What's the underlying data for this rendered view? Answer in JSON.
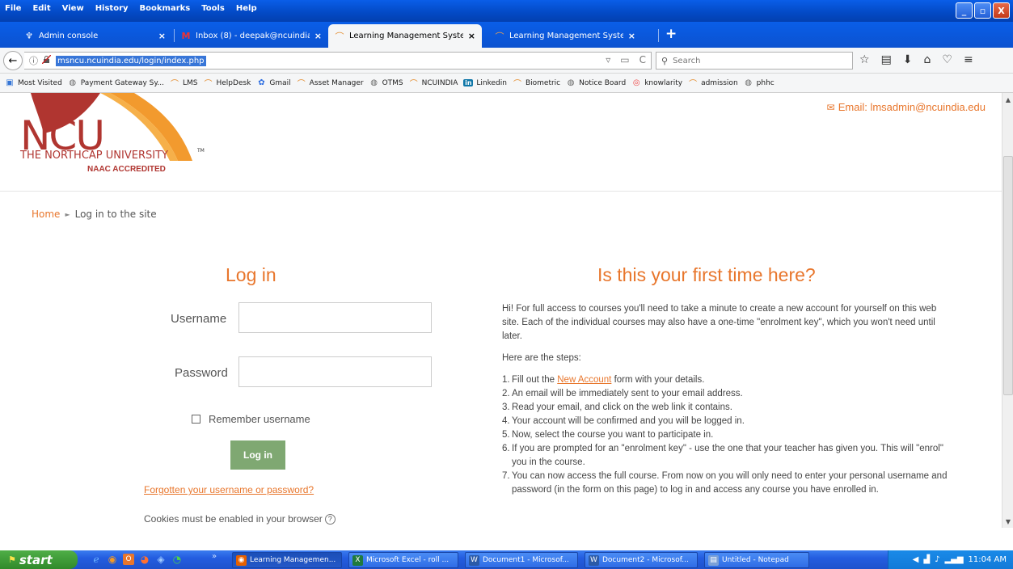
{
  "menu": [
    "File",
    "Edit",
    "View",
    "History",
    "Bookmarks",
    "Tools",
    "Help"
  ],
  "window_buttons": {
    "minimize": "_",
    "maximize": "▫",
    "close": "X"
  },
  "tabs": [
    {
      "title": "Admin console",
      "icon": "admin-console-icon",
      "glyph": "♆",
      "close": "×"
    },
    {
      "title": "Inbox (8) - deepak@ncuindia....",
      "icon": "gmail-icon",
      "glyph": "M",
      "close": "×"
    },
    {
      "title": "Learning Management Syste...",
      "icon": "lms-icon",
      "glyph": "⌒",
      "close": "×"
    },
    {
      "title": "Learning Management Syste...",
      "icon": "lms-icon",
      "glyph": "⌒",
      "close": "×"
    }
  ],
  "new_tab": "+",
  "nav": {
    "back": "←",
    "info": "ⓘ",
    "url": "msncu.ncuindia.edu/login/index.php",
    "reload": "C",
    "search_placeholder": "Search"
  },
  "bookmarks": [
    {
      "label": "Most Visited",
      "icon": "most-visited-icon",
      "glyph": "▣",
      "cls": "most"
    },
    {
      "label": "Payment Gateway Sy...",
      "icon": "globe-icon",
      "glyph": "◍",
      "cls": "globe"
    },
    {
      "label": "LMS",
      "icon": "lms-icon",
      "glyph": "⌒",
      "cls": "lms"
    },
    {
      "label": "HelpDesk",
      "icon": "lms-icon",
      "glyph": "⌒",
      "cls": "lms"
    },
    {
      "label": "Gmail",
      "icon": "gmail-icon",
      "glyph": "✿",
      "cls": "gmail"
    },
    {
      "label": "Asset Manager",
      "icon": "lms-icon",
      "glyph": "⌒",
      "cls": "lms"
    },
    {
      "label": "OTMS",
      "icon": "globe-icon",
      "glyph": "◍",
      "cls": "globe"
    },
    {
      "label": "NCUINDIA",
      "icon": "lms-icon",
      "glyph": "⌒",
      "cls": "lms"
    },
    {
      "label": "Linkedin",
      "icon": "linkedin-icon",
      "glyph": "in",
      "cls": "li"
    },
    {
      "label": "Biometric",
      "icon": "lms-icon",
      "glyph": "⌒",
      "cls": "lms"
    },
    {
      "label": "Notice Board",
      "icon": "globe-icon",
      "glyph": "◍",
      "cls": "globe"
    },
    {
      "label": "knowlarity",
      "icon": "knowlarity-icon",
      "glyph": "◎",
      "cls": "know"
    },
    {
      "label": "admission",
      "icon": "lms-icon",
      "glyph": "⌒",
      "cls": "lms"
    },
    {
      "label": "phhc",
      "icon": "globe-icon",
      "glyph": "◍",
      "cls": "globe"
    }
  ],
  "logo": {
    "mark": "NCU",
    "name": "THE NORTHCAP UNIVERSITY",
    "tm": "TM",
    "accreditation": "NAAC ACCREDITED"
  },
  "header": {
    "email_label": "Email: lmsadmin@ncuindia.edu"
  },
  "breadcrumb": {
    "home": "Home",
    "separator": "►",
    "current": "Log in to the site"
  },
  "login": {
    "title": "Log in",
    "username_label": "Username",
    "username_value": "",
    "password_label": "Password",
    "password_value": "",
    "remember_label": "Remember username",
    "button": "Log in",
    "forgot": "Forgotten your username or password?",
    "cookies": "Cookies must be enabled in your browser",
    "help": "?"
  },
  "first_time": {
    "title": "Is this your first time here?",
    "intro": "Hi! For full access to courses you'll need to take a minute to create a new account for yourself on this web site. Each of the individual courses may also have a one-time \"enrolment key\", which you won't need until later.",
    "steps_heading": "Here are the steps:",
    "step1_pre": "Fill out the ",
    "step1_link": "New Account",
    "step1_post": " form with your details.",
    "steps": [
      "An email will be immediately sent to your email address.",
      "Read your email, and click on the web link it contains.",
      "Your account will be confirmed and you will be logged in.",
      "Now, select the course you want to participate in.",
      "If you are prompted for an \"enrolment key\" - use the one that your teacher has given you. This will \"enrol\" you in the course.",
      "You can now access the full course. From now on you will only need to enter your personal username and password (in the form on this page) to log in and access any course you have enrolled in."
    ]
  },
  "taskbar": {
    "start": "start",
    "tasks": [
      {
        "label": "Learning Managemen...",
        "icon": "firefox-icon",
        "color": "#e66000",
        "glyph": "◉"
      },
      {
        "label": "Microsoft Excel - roll ...",
        "icon": "excel-icon",
        "color": "#1f7a3e",
        "glyph": "X"
      },
      {
        "label": "Document1 - Microsof...",
        "icon": "word-icon",
        "color": "#2b5aa8",
        "glyph": "W"
      },
      {
        "label": "Document2 - Microsof...",
        "icon": "word-icon",
        "color": "#2b5aa8",
        "glyph": "W"
      },
      {
        "label": "Untitled - Notepad",
        "icon": "notepad-icon",
        "color": "#7aa0d8",
        "glyph": "▤"
      }
    ],
    "clock": "11:04 AM"
  }
}
